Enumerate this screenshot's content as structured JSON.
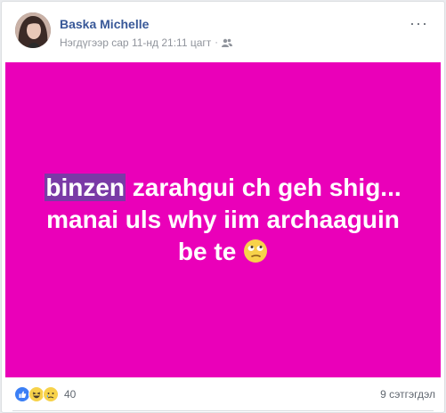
{
  "post": {
    "author": "Baska Michelle",
    "timestamp": "Нэгдүгээр сар 11-нд 21:11 цагт",
    "audience_icon": "friends-icon",
    "text_highlight": "binzen",
    "text_line1_rest": " zarahgui ch geh shig...",
    "text_line2": "manai uls why iim archaaguin",
    "text_line3": "be te",
    "background_color": "#ea00b9"
  },
  "footer": {
    "reaction_count": "40",
    "comments": "9 сэтгэгдэл"
  }
}
